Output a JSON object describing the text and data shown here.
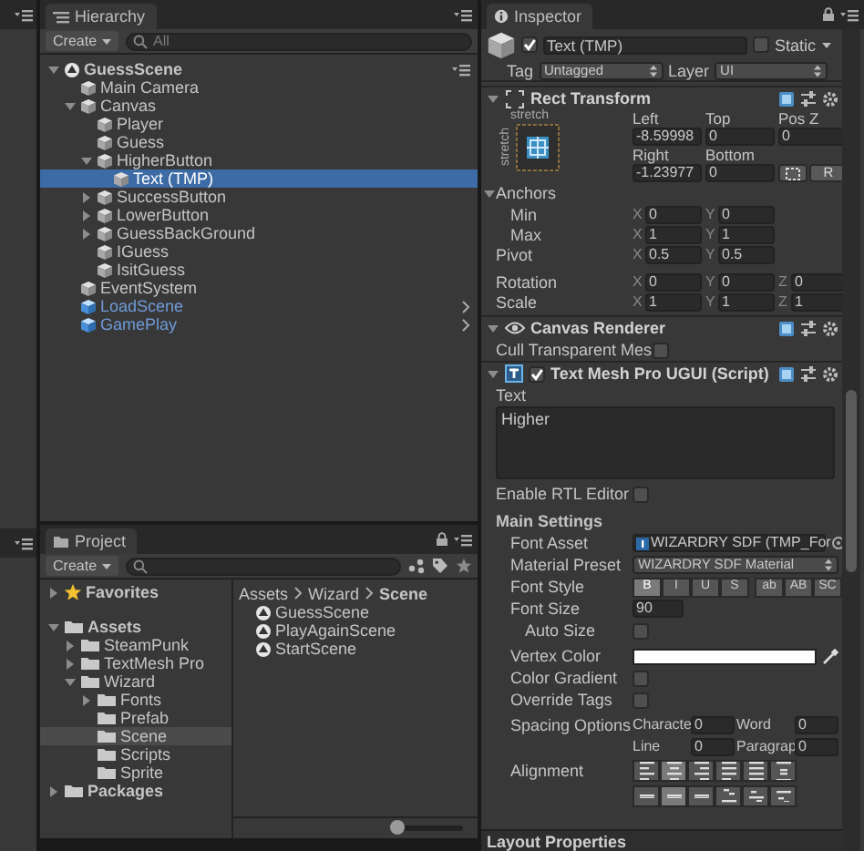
{
  "hierarchy": {
    "tab": "Hierarchy",
    "create": "Create",
    "search": {
      "placeholder": "All"
    },
    "tree": [
      {
        "name": "GuessScene",
        "kind": "scene",
        "expanded": true,
        "selected": false,
        "children": [
          {
            "name": "Main Camera",
            "kind": "object",
            "selected": false
          },
          {
            "name": "Canvas",
            "kind": "object",
            "expanded": true,
            "selected": false,
            "children": [
              {
                "name": "Player",
                "kind": "object",
                "selected": false
              },
              {
                "name": "Guess",
                "kind": "object",
                "selected": false
              },
              {
                "name": "HigherButton",
                "kind": "object",
                "expanded": true,
                "selected": false,
                "children": [
                  {
                    "name": "Text (TMP)",
                    "kind": "object",
                    "selected": true
                  }
                ]
              },
              {
                "name": "SuccessButton",
                "kind": "object",
                "expanded": false,
                "selected": false
              },
              {
                "name": "LowerButton",
                "kind": "object",
                "expanded": false,
                "selected": false
              },
              {
                "name": "GuessBackGround",
                "kind": "object",
                "expanded": false,
                "selected": false
              },
              {
                "name": "IGuess",
                "kind": "object",
                "selected": false
              },
              {
                "name": "IsitGuess",
                "kind": "object",
                "selected": false
              }
            ]
          },
          {
            "name": "EventSystem",
            "kind": "object",
            "selected": false
          },
          {
            "name": "LoadScene",
            "kind": "prefab",
            "selected": false
          },
          {
            "name": "GamePlay",
            "kind": "prefab",
            "selected": false
          }
        ]
      }
    ]
  },
  "project": {
    "tab": "Project",
    "create": "Create",
    "tree": [
      {
        "name": "Favorites",
        "kind": "favorites",
        "expanded": false,
        "selected": false
      },
      {
        "name": "Assets",
        "kind": "folder",
        "expanded": true,
        "selected": false,
        "children": [
          {
            "name": "SteamPunk",
            "kind": "folder",
            "expanded": false,
            "selected": false
          },
          {
            "name": "TextMesh Pro",
            "kind": "folder",
            "expanded": false,
            "selected": false
          },
          {
            "name": "Wizard",
            "kind": "folder",
            "expanded": true,
            "selected": false,
            "children": [
              {
                "name": "Fonts",
                "kind": "folder",
                "expanded": false,
                "selected": false
              },
              {
                "name": "Prefab",
                "kind": "folder",
                "selected": false
              },
              {
                "name": "Scene",
                "kind": "folder",
                "selected": true
              },
              {
                "name": "Scripts",
                "kind": "folder",
                "selected": false
              },
              {
                "name": "Sprite",
                "kind": "folder",
                "selected": false
              }
            ]
          }
        ]
      },
      {
        "name": "Packages",
        "kind": "folder",
        "expanded": false,
        "selected": false
      }
    ],
    "breadcrumb": [
      {
        "label": "Assets"
      },
      {
        "label": "Wizard"
      },
      {
        "label": "Scene"
      }
    ],
    "files": [
      {
        "name": "GuessScene",
        "kind": "scene"
      },
      {
        "name": "PlayAgainScene",
        "kind": "scene"
      },
      {
        "name": "StartScene",
        "kind": "scene"
      }
    ],
    "zoom_slider": {
      "level": 0
    }
  },
  "inspector": {
    "tab": "Inspector",
    "object": {
      "active": true,
      "name": "Text (TMP)",
      "static": false,
      "static_label": "Static",
      "tag_label": "Tag",
      "tag": "Untagged",
      "layer_label": "Layer",
      "layer": "UI"
    },
    "rect_transform": {
      "title": "Rect Transform",
      "expanded": true,
      "anchor_h": "stretch",
      "anchor_v": "stretch",
      "position_fields": [
        {
          "label": "Left",
          "value": "-8.59998"
        },
        {
          "label": "Top",
          "value": "0"
        },
        {
          "label": "Pos Z",
          "value": "0"
        },
        {
          "label": "Right",
          "value": "-1.23977"
        },
        {
          "label": "Bottom",
          "value": "0"
        }
      ],
      "raw_button": "R",
      "anchors": {
        "label": "Anchors",
        "expanded": true,
        "rows": [
          {
            "label": "Min",
            "axes": [
              {
                "axis": "X",
                "value": "0"
              },
              {
                "axis": "Y",
                "value": "0"
              }
            ]
          },
          {
            "label": "Max",
            "axes": [
              {
                "axis": "X",
                "value": "1"
              },
              {
                "axis": "Y",
                "value": "1"
              }
            ]
          }
        ]
      },
      "vectors": [
        {
          "label": "Pivot",
          "axes": [
            {
              "axis": "X",
              "value": "0.5"
            },
            {
              "axis": "Y",
              "value": "0.5"
            }
          ]
        },
        {
          "label": "Rotation",
          "axes": [
            {
              "axis": "X",
              "value": "0"
            },
            {
              "axis": "Y",
              "value": "0"
            },
            {
              "axis": "Z",
              "value": "0"
            }
          ]
        },
        {
          "label": "Scale",
          "axes": [
            {
              "axis": "X",
              "value": "1"
            },
            {
              "axis": "Y",
              "value": "1"
            },
            {
              "axis": "Z",
              "value": "1"
            }
          ]
        }
      ]
    },
    "canvas_renderer": {
      "title": "Canvas Renderer",
      "expanded": true,
      "cull_label": "Cull Transparent Mes",
      "cull": false
    },
    "tmp": {
      "title": "Text Mesh Pro UGUI (Script)",
      "enabled": true,
      "expanded": true,
      "text_label": "Text",
      "text": "Higher",
      "rtl_label": "Enable RTL Editor",
      "rtl": false,
      "section": "Main Settings",
      "font_asset_label": "Font Asset",
      "font_asset": "WIZARDRY SDF (TMP_For",
      "material_label": "Material Preset",
      "material": "WIZARDRY SDF Material",
      "font_style_label": "Font Style",
      "font_styles": [
        {
          "label": "B",
          "selected": true
        },
        {
          "label": "I",
          "selected": false
        },
        {
          "label": "U",
          "selected": false
        },
        {
          "label": "S",
          "selected": false
        },
        {
          "label": "ab",
          "selected": false
        },
        {
          "label": "AB",
          "selected": false
        },
        {
          "label": "SC",
          "selected": false
        }
      ],
      "font_size_label": "Font Size",
      "font_size": "90",
      "auto_size_label": "Auto Size",
      "auto_size": false,
      "vertex_color_label": "Vertex Color",
      "gradient_label": "Color Gradient",
      "gradient": false,
      "override_label": "Override Tags",
      "override": false,
      "spacing_label": "Spacing Options",
      "spacing": [
        {
          "label": "Characte",
          "value": "0"
        },
        {
          "label": "Word",
          "value": "0"
        },
        {
          "label": "Line",
          "value": "0"
        },
        {
          "label": "Paragrap",
          "value": "0"
        }
      ],
      "alignment_label": "Alignment",
      "align_h": [
        {
          "kind": "left",
          "selected": false
        },
        {
          "kind": "center",
          "selected": true
        },
        {
          "kind": "right",
          "selected": false
        },
        {
          "kind": "justified",
          "selected": false
        },
        {
          "kind": "flush",
          "selected": false
        },
        {
          "kind": "geometry",
          "selected": false
        }
      ],
      "align_v": [
        {
          "kind": "top",
          "selected": false
        },
        {
          "kind": "middle",
          "selected": true
        },
        {
          "kind": "bottom",
          "selected": false
        },
        {
          "kind": "baseline",
          "selected": false
        },
        {
          "kind": "midline",
          "selected": false
        },
        {
          "kind": "capline",
          "selected": false
        }
      ]
    },
    "layout_properties": "Layout Properties"
  }
}
